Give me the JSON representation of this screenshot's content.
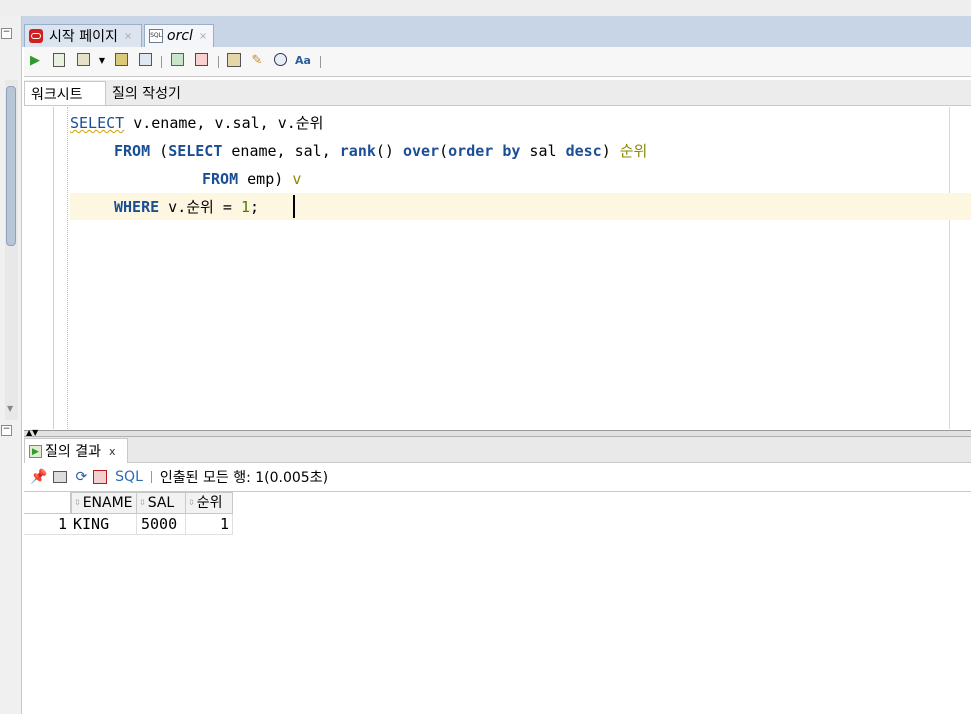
{
  "tabs": [
    {
      "label": "시작 페이지",
      "close": "×",
      "icon": "oracle-logo-icon"
    },
    {
      "label": "orcl",
      "close": "×",
      "icon": "sql-file-icon"
    }
  ],
  "toolbar": {
    "icons": [
      "run-statement-icon",
      "run-script-icon",
      "autotrace-icon",
      "dropdown-icon",
      "explain-plan-icon",
      "sql-tuning-icon",
      "commit-icon",
      "rollback-icon",
      "unshared-sql-icon",
      "clear-icon",
      "history-icon",
      "format-icon"
    ]
  },
  "subtabs": {
    "worksheet": "워크시트",
    "query_builder": "질의 작성기"
  },
  "editor": {
    "line1": {
      "kw": "SELECT",
      "rest": " v.ename, v.sal, v.순위"
    },
    "line2": {
      "kw1": "FROM",
      "p1": " (",
      "kw2": "SELECT",
      "p2": " ename, sal, ",
      "kw3": "rank",
      "p3": "() ",
      "kw4": "over",
      "p4": "(",
      "kw5": "order",
      "p5": " ",
      "kw6": "by",
      "p6": " sal ",
      "kw7": "desc",
      "p7": ") ",
      "alias": "순위"
    },
    "line3": {
      "kw": "FROM",
      "rest": " emp) ",
      "alias": "v"
    },
    "line4": {
      "kw": "WHERE",
      "p1": " v.순위 = ",
      "num": "1",
      "p2": ";"
    }
  },
  "results": {
    "tab_label": "질의 결과",
    "tab_close": "x",
    "sql_label": "SQL",
    "status": "인출된 모든 행: 1(0.005초)",
    "columns": [
      "ENAME",
      "SAL",
      "순위"
    ],
    "rows": [
      {
        "num": "1",
        "cells": [
          "KING",
          "5000",
          "1"
        ]
      }
    ]
  }
}
